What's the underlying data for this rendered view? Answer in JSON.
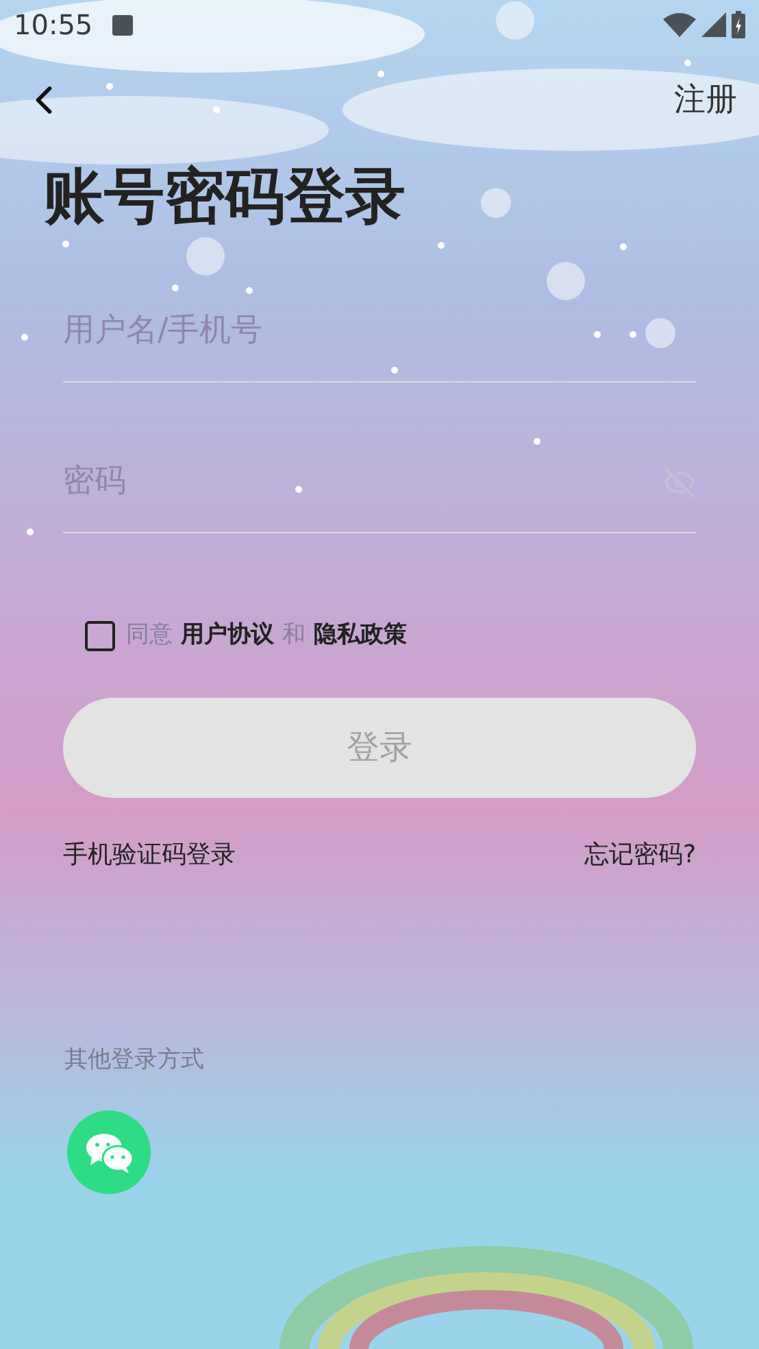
{
  "status_bar": {
    "time": "10:55"
  },
  "nav": {
    "register": "注册"
  },
  "title": "账号密码登录",
  "fields": [
    {
      "kind": "text",
      "placeholder": "用户名/手机号"
    },
    {
      "kind": "password",
      "placeholder": "密码"
    }
  ],
  "agreement": {
    "checked": false,
    "parts": [
      {
        "kind": "plain",
        "text": "同意"
      },
      {
        "kind": "link",
        "text": "用户协议"
      },
      {
        "kind": "plain",
        "text": "和"
      },
      {
        "kind": "link",
        "text": "隐私政策"
      }
    ]
  },
  "login_button": {
    "label": "登录",
    "disabled": true
  },
  "links": {
    "sms_login": "手机验证码登录",
    "forgot_password": "忘记密码?"
  },
  "other_login": {
    "title": "其他登录方式"
  }
}
